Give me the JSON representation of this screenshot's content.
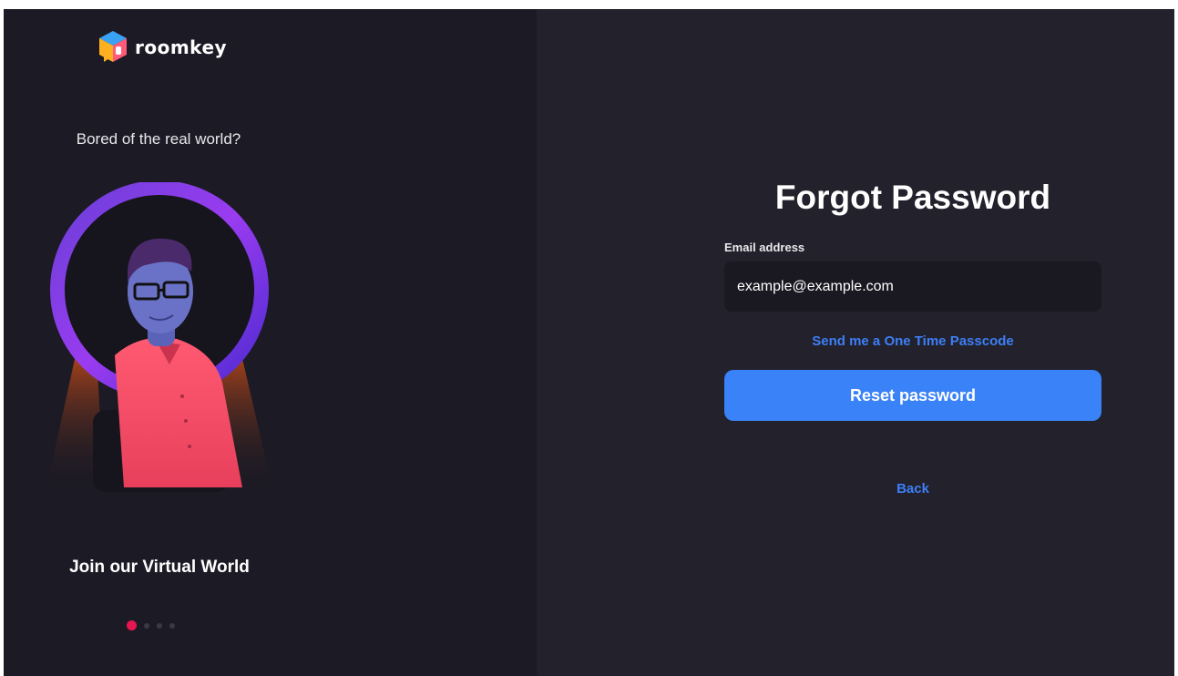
{
  "brand": {
    "name": "roomkey",
    "logo_icon": "cube-logo-icon"
  },
  "promo": {
    "tagline": "Bored of the real world?",
    "title": "Join our Virtual World",
    "carousel": {
      "total": 4,
      "active_index": 0
    },
    "accent_color": "#e8164f"
  },
  "form": {
    "title": "Forgot Password",
    "email_label": "Email address",
    "email_placeholder": "example@example.com",
    "otp_link": "Send me a One Time Passcode",
    "reset_button": "Reset password",
    "back_link": "Back"
  },
  "colors": {
    "left_background": "#1c1a24",
    "right_background": "#22212c",
    "primary": "#3a82f7",
    "link": "#3d7ff5"
  }
}
